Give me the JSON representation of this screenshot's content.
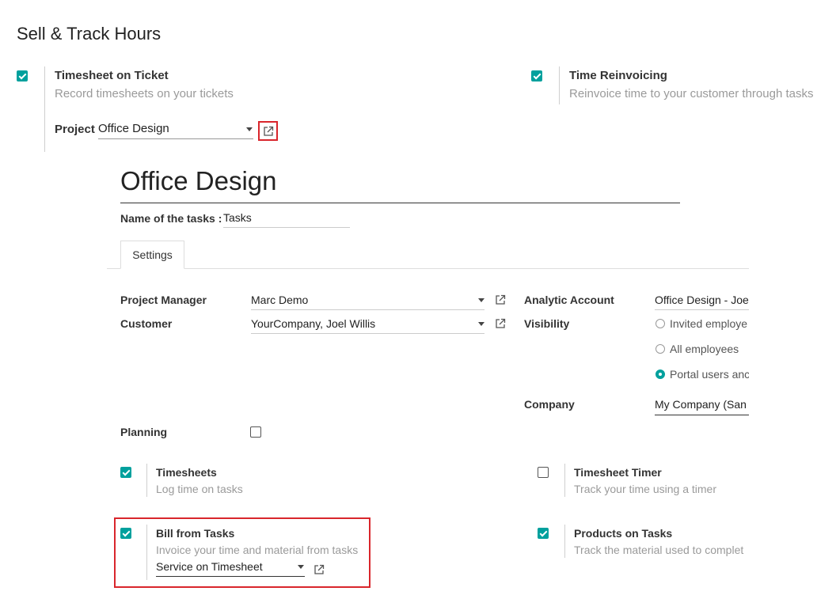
{
  "section_title": "Sell & Track Hours",
  "timesheet_on_ticket": {
    "title": "Timesheet on Ticket",
    "description": "Record timesheets on your tickets",
    "checked": true,
    "project_label": "Project",
    "project_value": "Office Design"
  },
  "time_reinvoicing": {
    "title": "Time Reinvoicing",
    "description": "Reinvoice time to your customer through tasks",
    "checked": true
  },
  "project_form": {
    "name": "Office Design",
    "tasks_label": "Name of the tasks :",
    "tasks_value": "Tasks",
    "tab_settings": "Settings",
    "project_manager_label": "Project Manager",
    "project_manager_value": "Marc Demo",
    "customer_label": "Customer",
    "customer_value": "YourCompany, Joel Willis",
    "analytic_account_label": "Analytic Account",
    "analytic_account_value": "Office Design - Joe",
    "visibility_label": "Visibility",
    "visibility_options": [
      "Invited employe",
      "All employees",
      "Portal users anc"
    ],
    "visibility_selected_index": 2,
    "company_label": "Company",
    "company_value": "My Company (San",
    "planning_label": "Planning",
    "planning_checked": false,
    "timesheets": {
      "title": "Timesheets",
      "description": "Log time on tasks",
      "checked": true
    },
    "timesheet_timer": {
      "title": "Timesheet Timer",
      "description": "Track your time using a timer",
      "checked": false
    },
    "bill_from_tasks": {
      "title": "Bill from Tasks",
      "description": "Invoice your time and material from tasks",
      "checked": true,
      "service_value": "Service on Timesheet"
    },
    "products_on_tasks": {
      "title": "Products on Tasks",
      "description": "Track the material used to complet",
      "checked": true
    }
  },
  "colors": {
    "accent": "#00a09d",
    "highlight_box": "#d9262c"
  }
}
